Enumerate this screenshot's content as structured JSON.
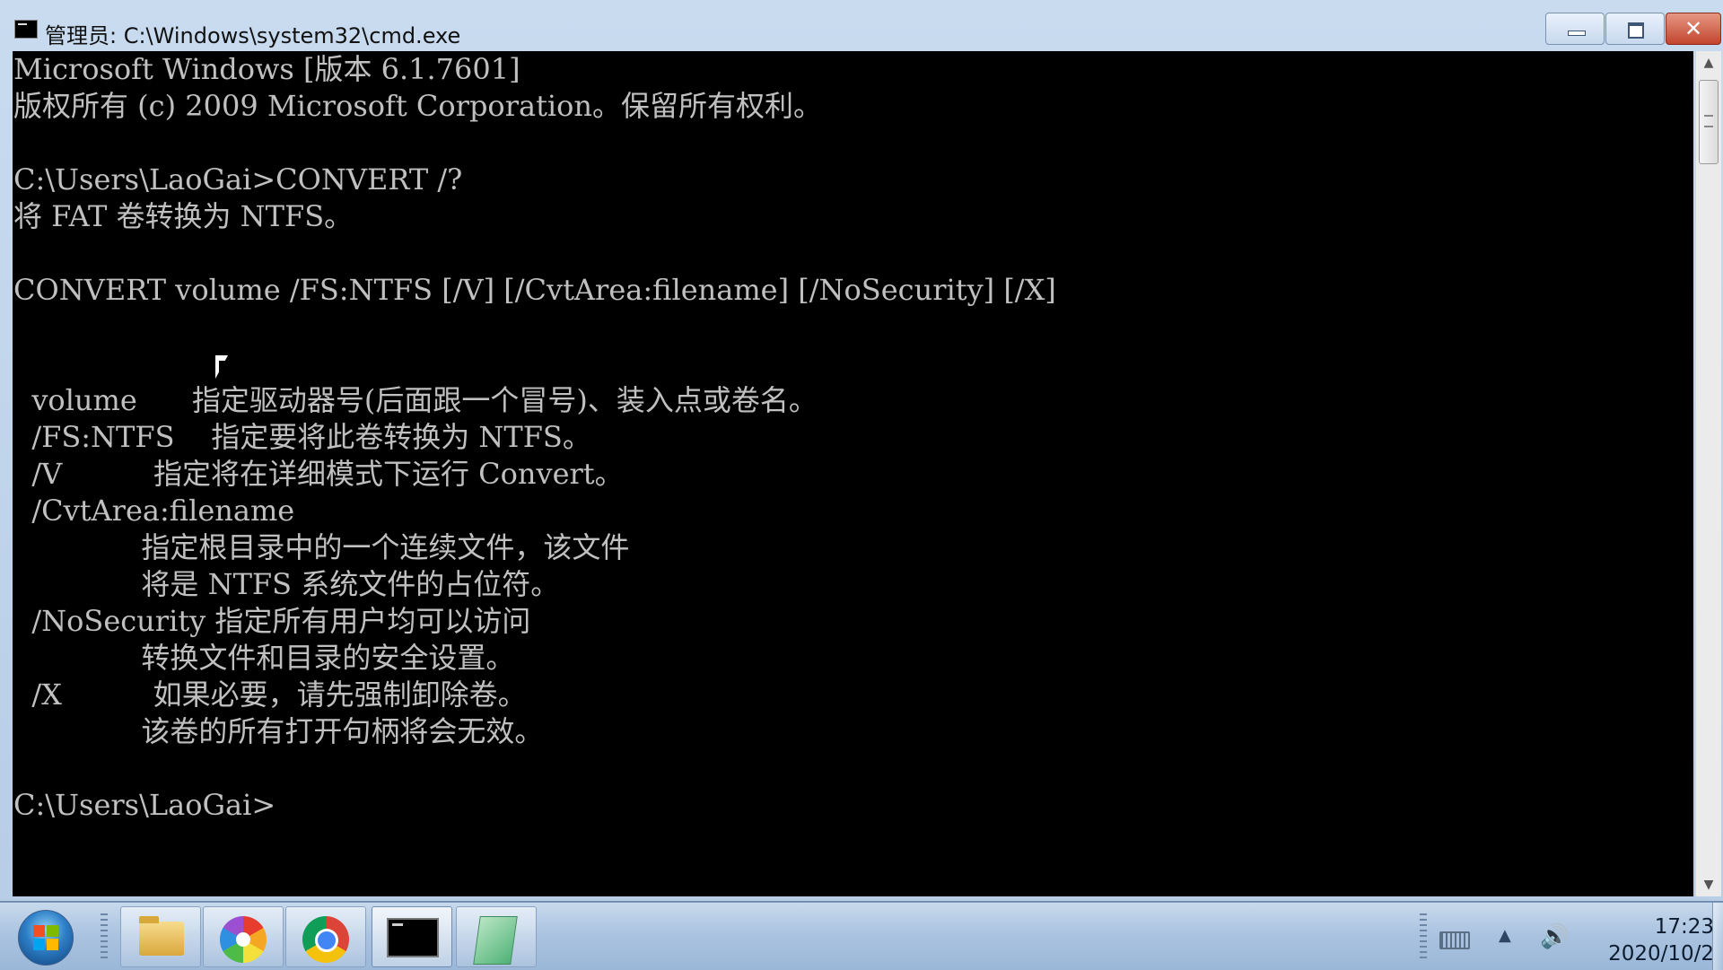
{
  "window": {
    "title": "管理员: C:\\Windows\\system32\\cmd.exe",
    "close_glyph": "✕"
  },
  "console": {
    "lines": [
      "Microsoft Windows [版本 6.1.7601]",
      "版权所有 (c) 2009 Microsoft Corporation。保留所有权利。",
      "",
      "C:\\Users\\LaoGai>CONVERT /?",
      "将 FAT 卷转换为 NTFS。",
      "",
      "CONVERT volume /FS:NTFS [/V] [/CvtArea:filename] [/NoSecurity] [/X]",
      "",
      "",
      "  volume      指定驱动器号(后面跟一个冒号)、装入点或卷名。",
      "  /FS:NTFS    指定要将此卷转换为 NTFS。",
      "  /V          指定将在详细模式下运行 Convert。",
      "  /CvtArea:filename",
      "              指定根目录中的一个连续文件，该文件",
      "              将是 NTFS 系统文件的占位符。",
      "  /NoSecurity 指定所有用户均可以访问",
      "              转换文件和目录的安全设置。",
      "  /X          如果必要，请先强制卸除卷。",
      "              该卷的所有打开句柄将会无效。",
      "",
      "C:\\Users\\LaoGai>"
    ],
    "text_color": "#c0c0c0",
    "background": "#000000"
  },
  "scrollbar": {
    "up_arrow": "▲",
    "down_arrow": "▼"
  },
  "taskbar": {
    "apps": [
      "file-explorer",
      "pinwheel-app",
      "chrome",
      "cmd",
      "sticky-notes"
    ],
    "tray_arrow": "▲",
    "speaker": "🔊",
    "clock_time": "17:23",
    "clock_date": "2020/10/2"
  }
}
